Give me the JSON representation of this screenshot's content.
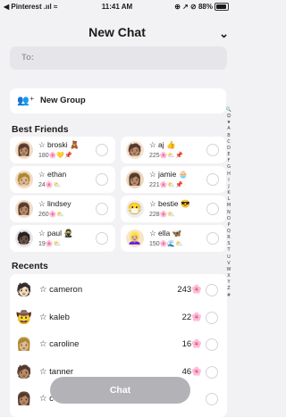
{
  "status": {
    "carrier": "◀ Pinterest .ııl ≈",
    "time": "11:41 AM",
    "right": "⊕ ↗ ⊘ 88%"
  },
  "header": {
    "title": "New Chat"
  },
  "to": {
    "label": "To:"
  },
  "new_group": {
    "label": "New Group"
  },
  "best_friends": {
    "heading": "Best Friends",
    "items": [
      {
        "name": "☆ broski 🧸",
        "score": "180🌸💛📌",
        "avatar": "👩🏽",
        "bg": "#f2dcc4"
      },
      {
        "name": "☆ aj 👍",
        "score": "225🌸⛅📌",
        "avatar": "🧑🏽",
        "bg": "#f3e3cf"
      },
      {
        "name": "☆ ethan",
        "score": "24🌸⛅",
        "avatar": "🧑🏼",
        "bg": "#f2dcc4"
      },
      {
        "name": "☆ jamie 🧁",
        "score": "221🌸⛅📌",
        "avatar": "👩🏽",
        "bg": "#eed7bf"
      },
      {
        "name": "☆ lindsey",
        "score": "260🌸⛅",
        "avatar": "👩🏽",
        "bg": "#f2dcc4"
      },
      {
        "name": "☆ bestie 😎",
        "score": "228🌸⛅",
        "avatar": "😷",
        "bg": "#e9eef2"
      },
      {
        "name": "☆ paul 🥷",
        "score": "19🌸⛅",
        "avatar": "🧑🏿",
        "bg": "#e6e6e6"
      },
      {
        "name": "☆ ella 🦋",
        "score": "150🌸🌊⛅",
        "avatar": "👱🏼‍♀️",
        "bg": "#f6e6c8"
      }
    ]
  },
  "recents": {
    "heading": "Recents",
    "items": [
      {
        "name": "☆ cameron",
        "score": "243🌸",
        "avatar": "🧑🏻"
      },
      {
        "name": "☆ kaleb",
        "score": "22🌸",
        "avatar": "🤠"
      },
      {
        "name": "☆ caroline",
        "score": "16🌸",
        "avatar": "👩🏼"
      },
      {
        "name": "☆ tanner",
        "score": "46🌸",
        "avatar": "🧑🏽"
      },
      {
        "name": "☆ c",
        "score": "",
        "avatar": "👩🏽"
      }
    ]
  },
  "alphabet": [
    "🔍",
    "😊",
    "★",
    "A",
    "B",
    "C",
    "D",
    "E",
    "F",
    "G",
    "H",
    "I",
    "J",
    "K",
    "L",
    "M",
    "N",
    "O",
    "P",
    "Q",
    "R",
    "S",
    "T",
    "U",
    "V",
    "W",
    "X",
    "Y",
    "Z",
    "#"
  ],
  "chat_button": {
    "label": "Chat"
  }
}
